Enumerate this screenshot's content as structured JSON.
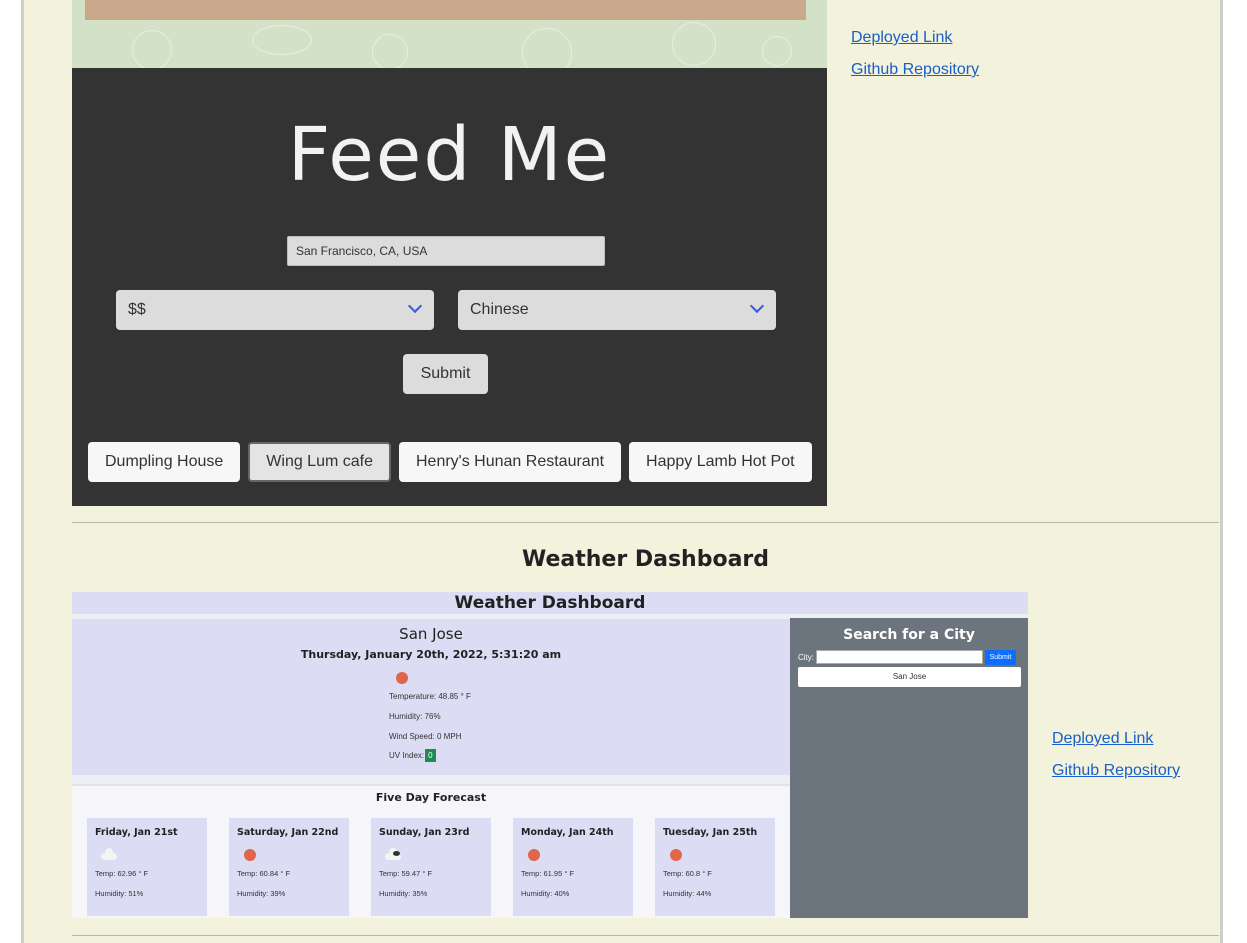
{
  "projects": [
    {
      "shot": {
        "app_title": "Feed Me",
        "location_value": "San Francisco, CA, USA",
        "price_select_value": "$$",
        "cuisine_select_value": "Chinese",
        "submit_label": "Submit",
        "results": [
          "Dumpling House",
          "Wing Lum cafe",
          "Henry's Hunan Restaurant",
          "Happy Lamb Hot Pot"
        ]
      },
      "deployed_link": "Deployed Link",
      "repo_link": "Github Repository"
    },
    {
      "title": "Weather Dashboard",
      "shot": {
        "header": "Weather Dashboard",
        "current": {
          "city": "San Jose",
          "datetime": "Thursday, January 20th, 2022, 5:31:20 am",
          "icon": "sun-icon",
          "temperature": "Temperature: 48.85 ° F",
          "humidity": "Humidity: 76%",
          "wind": "Wind Speed: 0 MPH",
          "uv_label": "UV Index:",
          "uv_value": "0"
        },
        "forecast_title": "Five Day Forecast",
        "forecast": [
          {
            "day": "Friday, Jan 21st",
            "icon": "cloud-icon",
            "temp": "Temp: 62.96 ° F",
            "humidity": "Humidity: 51%"
          },
          {
            "day": "Saturday, Jan 22nd",
            "icon": "sun-icon",
            "temp": "Temp: 60.84 ° F",
            "humidity": "Humidity: 39%"
          },
          {
            "day": "Sunday, Jan 23rd",
            "icon": "cloud-icon",
            "temp": "Temp: 59.47 ° F",
            "humidity": "Humidity: 35%"
          },
          {
            "day": "Monday, Jan 24th",
            "icon": "sun-icon",
            "temp": "Temp: 61.95 ° F",
            "humidity": "Humidity: 40%"
          },
          {
            "day": "Tuesday, Jan 25th",
            "icon": "sun-icon",
            "temp": "Temp: 60.8 ° F",
            "humidity": "Humidity: 44%"
          }
        ],
        "search_title": "Search for a City",
        "city_label": "City:",
        "city_input_value": "",
        "search_submit": "Submit",
        "history": [
          "San Jose"
        ]
      },
      "deployed_link": "Deployed Link",
      "repo_link": "Github Repository"
    }
  ],
  "colors": {
    "page_background": "#f3f2dd",
    "link": "#1a5fc6",
    "feedme_panel": "#333333",
    "weather_panel": "#dcdcf5",
    "weather_sidebar": "#6c757d",
    "uv_badge": "#1e8b4f",
    "submit_button": "#0d6efd"
  }
}
